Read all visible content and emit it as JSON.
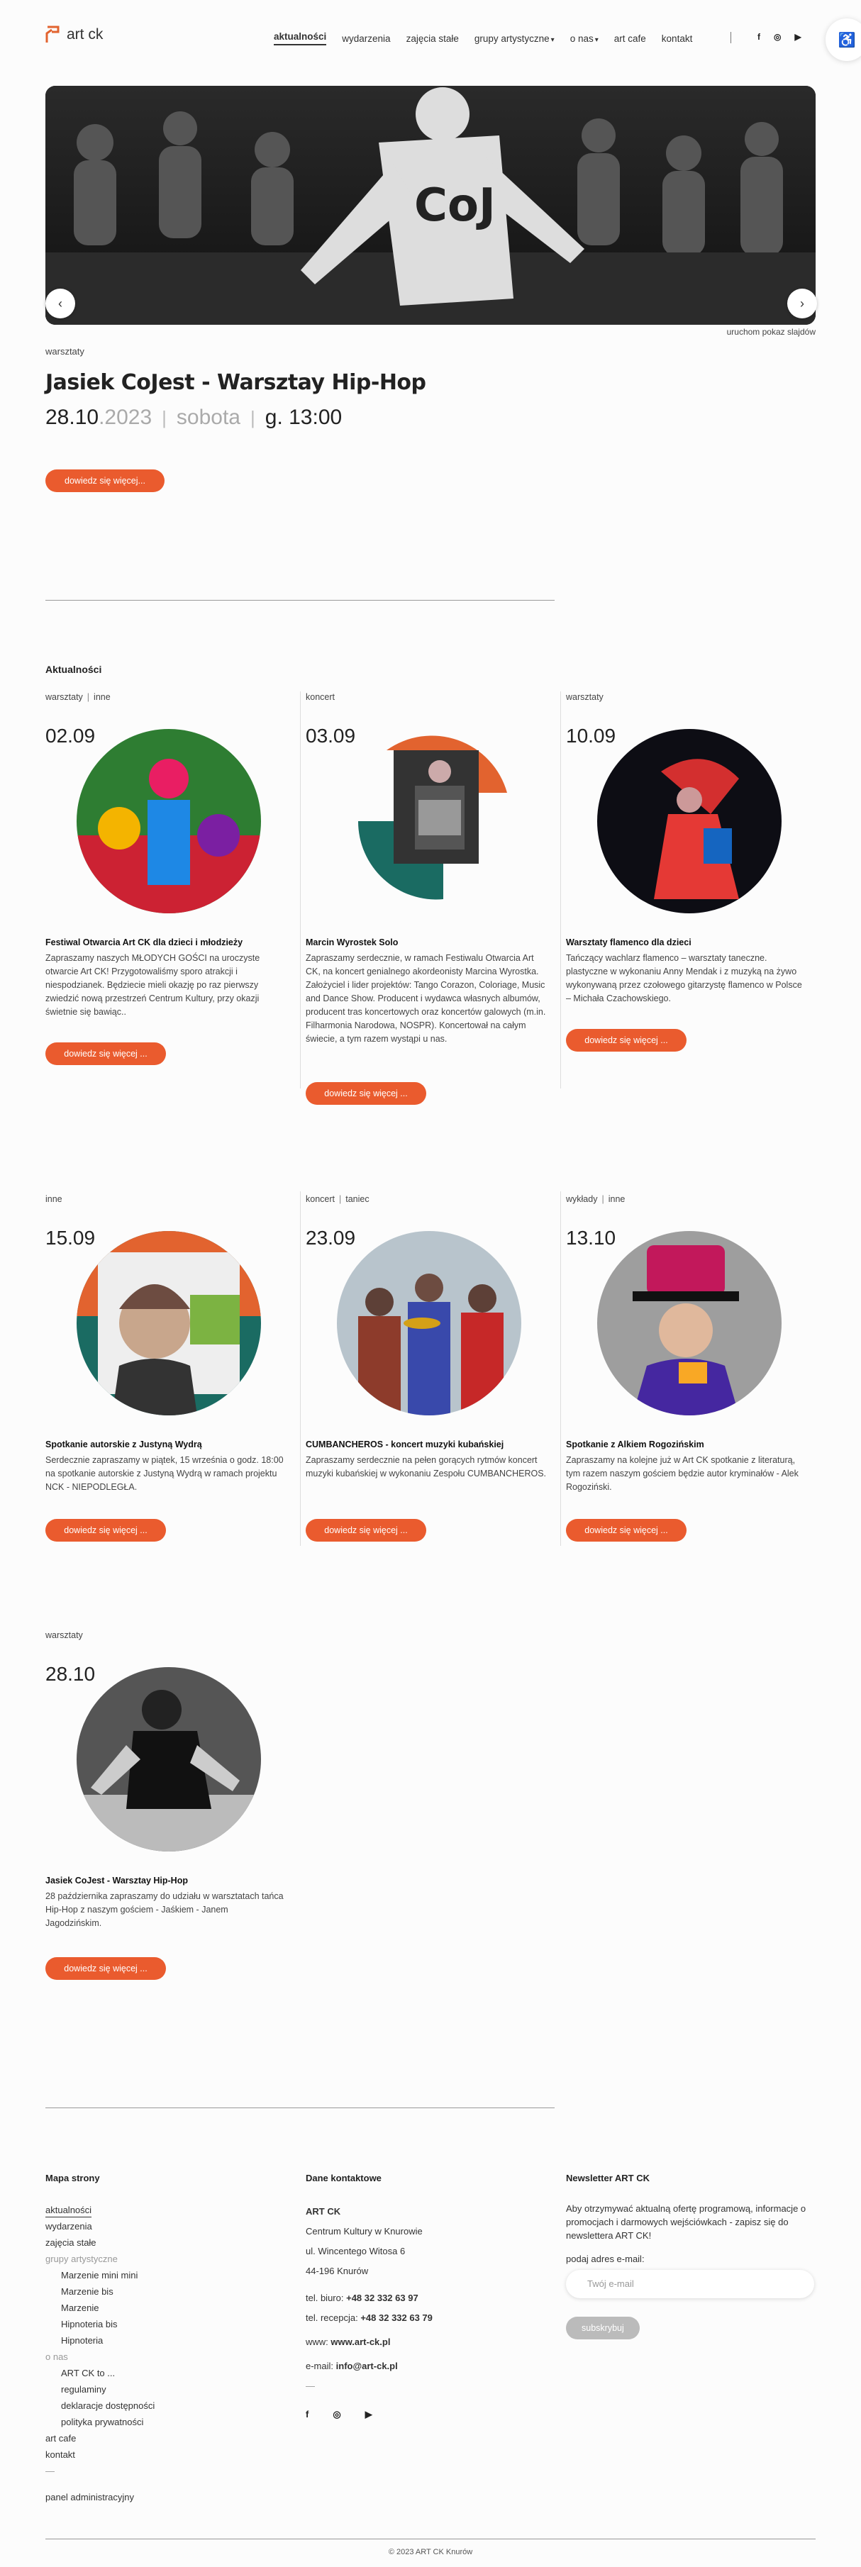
{
  "header": {
    "logo_text": "art ck",
    "nav": [
      {
        "label": "aktualności",
        "active": true,
        "dropdown": false
      },
      {
        "label": "wydarzenia",
        "active": false,
        "dropdown": false
      },
      {
        "label": "zajęcia stałe",
        "active": false,
        "dropdown": false
      },
      {
        "label": "grupy artystyczne",
        "active": false,
        "dropdown": true
      },
      {
        "label": "o nas",
        "active": false,
        "dropdown": true
      },
      {
        "label": "art cafe",
        "active": false,
        "dropdown": false
      },
      {
        "label": "kontakt",
        "active": false,
        "dropdown": false
      }
    ],
    "social_icons": [
      "facebook-icon",
      "instagram-icon",
      "youtube-icon"
    ],
    "accessibility_icon": "wheelchair-icon"
  },
  "hero": {
    "slideshow_link": "uruchom pokaz slajdów",
    "category": "warsztaty",
    "title": "Jasiek CoJest - Warsztay Hip-Hop",
    "date_day": "28.10",
    "date_year": ".2023",
    "weekday": "sobota",
    "time": "g. 13:00",
    "button": "dowiedz się więcej..."
  },
  "section_title": "Aktualności",
  "cards": [
    {
      "categories": [
        "warsztaty",
        "inne"
      ],
      "date": "02.09",
      "title": "Festiwal Otwarcia Art CK dla dzieci i młodzieży",
      "desc": "Zapraszamy naszych MŁODYCH GOŚCI na uroczyste otwarcie Art CK! Przygotowaliśmy sporo atrakcji i niespodzianek. Będziecie mieli okazję po raz pierwszy zwiedzić nową przestrzeń Centrum Kultury, przy okazji świetnie się bawiąc..",
      "button": "dowiedz się więcej ..."
    },
    {
      "categories": [
        "koncert"
      ],
      "date": "03.09",
      "title": "Marcin Wyrostek Solo",
      "desc": "Zapraszamy serdecznie, w ramach Festiwalu Otwarcia Art CK, na koncert genialnego akordeonisty Marcina Wyrostka. Założyciel i lider projektów: Tango Corazon, Coloriage, Music and Dance Show. Producent i wydawca własnych albumów, producent tras koncertowych oraz koncertów galowych (m.in. Filharmonia Narodowa, NOSPR). Koncertował na całym świecie, a tym razem wystąpi u nas.",
      "button": "dowiedz się więcej ..."
    },
    {
      "categories": [
        "warsztaty"
      ],
      "date": "10.09",
      "title": "Warsztaty flamenco dla dzieci",
      "desc": "Tańczący wachlarz flamenco – warsztaty taneczne. plastyczne w wykonaniu Anny Mendak i z muzyką na żywo wykonywaną przez czołowego gitarzystę flamenco w Polsce – Michała Czachowskiego.",
      "button": "dowiedz się więcej ..."
    },
    {
      "categories": [
        "inne"
      ],
      "date": "15.09",
      "title": "Spotkanie autorskie z Justyną Wydrą",
      "desc": "Serdecznie zapraszamy w piątek, 15 września o godz. 18:00 na spotkanie autorskie z Justyną Wydrą w ramach projektu NCK - NIEPODLEGŁA.",
      "button": "dowiedz się więcej ..."
    },
    {
      "categories": [
        "koncert",
        "taniec"
      ],
      "date": "23.09",
      "title": "CUMBANCHEROS - koncert muzyki kubańskiej",
      "desc": "Zapraszamy serdecznie na pełen gorących rytmów koncert muzyki kubańskiej w wykonaniu Zespołu CUMBANCHEROS.",
      "button": "dowiedz się więcej ..."
    },
    {
      "categories": [
        "wykłady",
        "inne"
      ],
      "date": "13.10",
      "title": "Spotkanie z Alkiem Rogozińskim",
      "desc": "Zapraszamy na kolejne już w Art CK spotkanie z literaturą, tym razem naszym gościem będzie autor kryminałów - Alek Rogoziński.",
      "button": "dowiedz się więcej ..."
    },
    {
      "categories": [
        "warsztaty"
      ],
      "date": "28.10",
      "title": "Jasiek CoJest - Warsztay Hip-Hop",
      "desc": "28 października zapraszamy do udziału w warsztatach tańca Hip-Hop z naszym gościem - Jaśkiem - Janem Jagodzińskim.",
      "button": "dowiedz się więcej ..."
    }
  ],
  "footer": {
    "sitemap_title": "Mapa strony",
    "sitemap": [
      {
        "label": "aktualności",
        "kind": "active"
      },
      {
        "label": "wydarzenia",
        "kind": "normal"
      },
      {
        "label": "zajęcia stałe",
        "kind": "normal"
      },
      {
        "label": "grupy artystyczne",
        "kind": "muted"
      },
      {
        "label": "Marzenie mini mini",
        "kind": "sub"
      },
      {
        "label": "Marzenie bis",
        "kind": "sub"
      },
      {
        "label": "Marzenie",
        "kind": "sub"
      },
      {
        "label": "Hipnoteria bis",
        "kind": "sub"
      },
      {
        "label": "Hipnoteria",
        "kind": "sub"
      },
      {
        "label": "o nas",
        "kind": "muted"
      },
      {
        "label": "ART CK to ...",
        "kind": "sub"
      },
      {
        "label": "regulaminy",
        "kind": "sub"
      },
      {
        "label": "deklaracje dostępności",
        "kind": "sub"
      },
      {
        "label": "polityka prywatności",
        "kind": "sub"
      },
      {
        "label": "art cafe",
        "kind": "normal"
      },
      {
        "label": "kontakt",
        "kind": "normal"
      },
      {
        "label": "—",
        "kind": "muted"
      }
    ],
    "admin_link": "panel administracyjny",
    "contact_title": "Dane kontaktowe",
    "contact": {
      "name": "ART CK",
      "org": "Centrum Kultury w Knurowie",
      "street": "ul. Wincentego Witosa 6",
      "city": "44-196 Knurów",
      "office_label": "tel. biuro:",
      "office_phone": "+48 32 332 63 97",
      "reception_label": "tel. recepcja:",
      "reception_phone": "+48 32 332 63 79",
      "www_label": "www:",
      "www": "www.art-ck.pl",
      "email_label": "e-mail:",
      "email": "info@art-ck.pl",
      "dash": "—"
    },
    "newsletter_title": "Newsletter ART CK",
    "newsletter_text": "Aby otrzymywać aktualną ofertę programową, informacje o promocjach i darmowych wejściówkach - zapisz się do newslettera ART CK!",
    "email_label": "podaj adres e-mail:",
    "email_placeholder": "Twój e-mail",
    "subscribe": "subskrybuj",
    "copyright": "© 2023 ART CK Knurów"
  },
  "colors": {
    "accent": "#ea5b2e",
    "logo_orange": "#e2632f",
    "logo_teal": "#1a6b62"
  }
}
